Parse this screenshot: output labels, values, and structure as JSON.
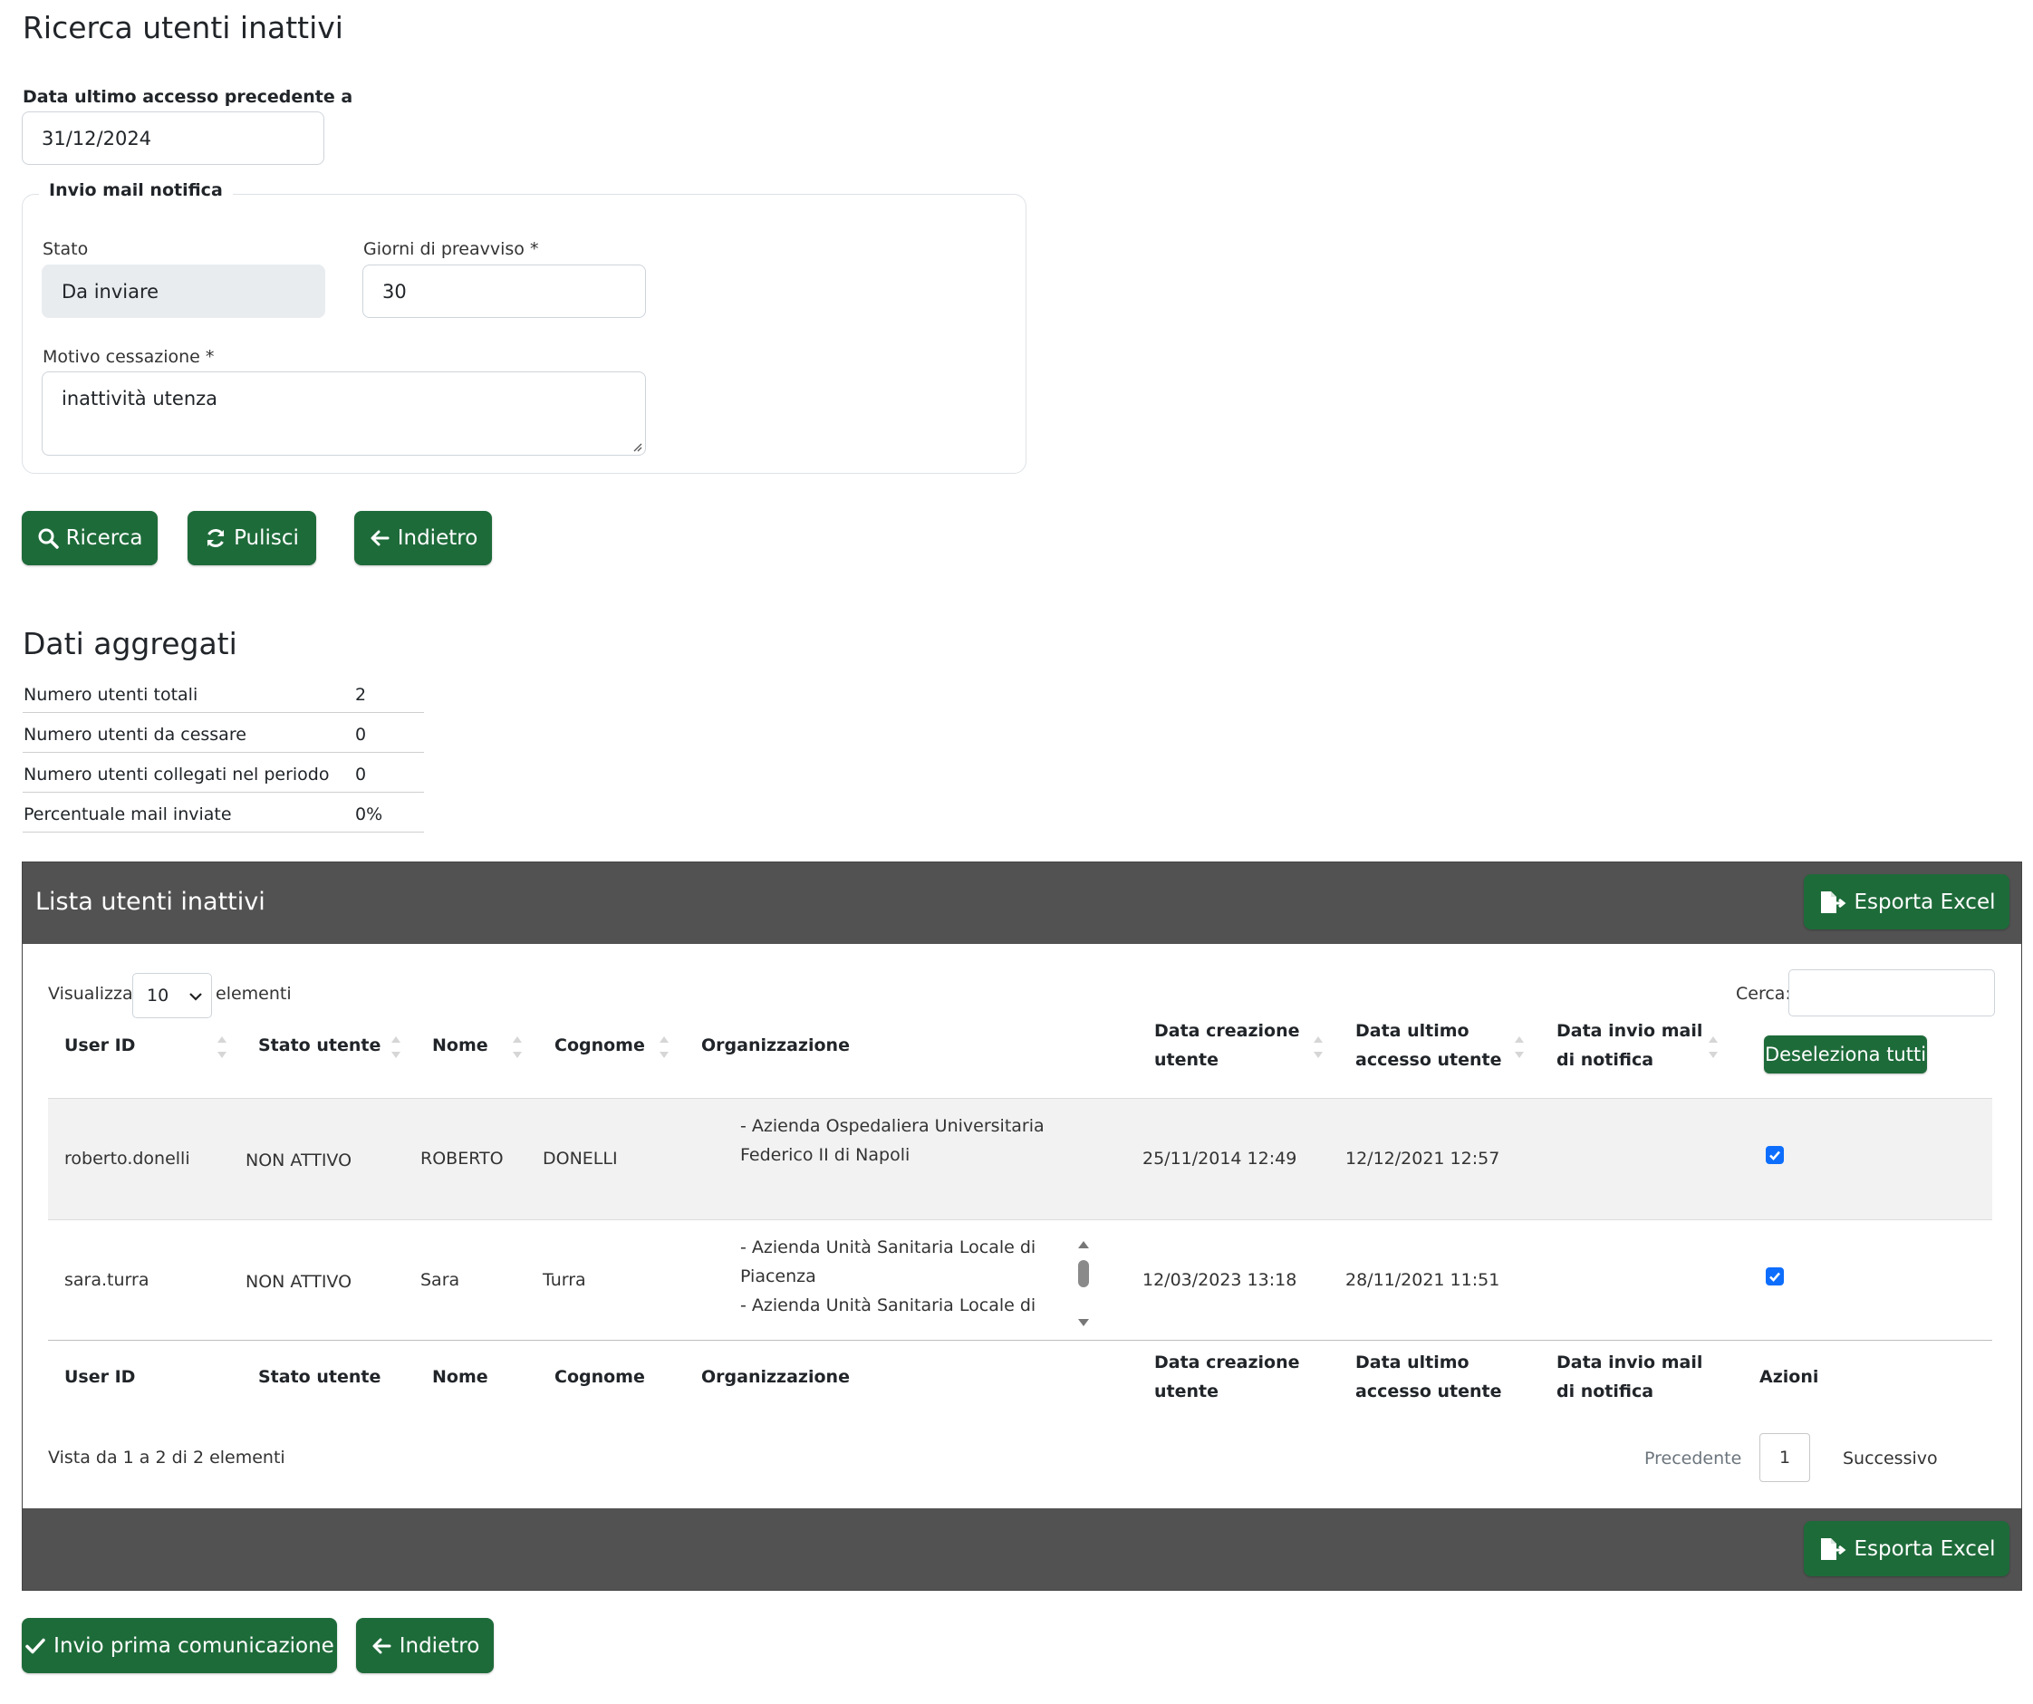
{
  "page": {
    "title": "Ricerca utenti inattivi"
  },
  "search": {
    "last_access_label": "Data ultimo accesso precedente a",
    "last_access_value": "31/12/2024",
    "notification_legend": "Invio mail notifica",
    "stato_label": "Stato",
    "stato_value": "Da inviare",
    "giorni_label": "Giorni di preavviso *",
    "giorni_value": "30",
    "motivo_label": "Motivo cessazione *",
    "motivo_value": "inattività utenza"
  },
  "actions": {
    "ricerca": "Ricerca",
    "pulisci": "Pulisci",
    "indietro": "Indietro"
  },
  "aggregate": {
    "title": "Dati aggregati",
    "rows": [
      {
        "label": "Numero utenti totali",
        "value": "2"
      },
      {
        "label": "Numero utenti da cessare",
        "value": "0"
      },
      {
        "label": "Numero utenti collegati nel periodo",
        "value": "0"
      },
      {
        "label": "Percentuale mail inviate",
        "value": "0%"
      }
    ]
  },
  "list": {
    "title": "Lista utenti inattivi",
    "export_label": "Esporta Excel",
    "show_label": "Visualizza",
    "page_size": "10",
    "elements_label": "elementi",
    "search_label": "Cerca:",
    "search_value": "",
    "deselect_all": "Deseleziona tutti",
    "columns": {
      "user_id": "User ID",
      "stato": "Stato utente",
      "nome": "Nome",
      "cognome": "Cognome",
      "org": "Organizzazione",
      "creazione_1": "Data creazione",
      "creazione_2": "utente",
      "accesso_1": "Data ultimo",
      "accesso_2": "accesso utente",
      "invio_1": "Data invio mail",
      "invio_2": "di notifica",
      "azioni": "Azioni"
    },
    "rows": [
      {
        "user_id": "roberto.donelli",
        "stato": "NON ATTIVO",
        "nome": "ROBERTO",
        "cognome": "DONELLI",
        "org_lines": [
          "- Azienda Ospedaliera Universitaria",
          "Federico II di Napoli"
        ],
        "creazione": "25/11/2014 12:49",
        "accesso": "12/12/2021 12:57",
        "invio": "",
        "selected": true
      },
      {
        "user_id": "sara.turra",
        "stato": "NON ATTIVO",
        "nome": "Sara",
        "cognome": "Turra",
        "org_lines": [
          "- Azienda Unità Sanitaria Locale di",
          "Piacenza",
          "- Azienda Unità Sanitaria Locale di"
        ],
        "creazione": "12/03/2023 13:18",
        "accesso": "28/11/2021 11:51",
        "invio": "",
        "selected": true
      }
    ],
    "info": "Vista da 1 a 2 di 2 elementi",
    "pagination": {
      "prev": "Precedente",
      "current": "1",
      "next": "Successivo"
    }
  },
  "bottom_actions": {
    "invio": "Invio prima comunicazione",
    "indietro": "Indietro"
  },
  "colors": {
    "primary": "#1e6b3a",
    "panel_header": "#525252",
    "checkbox": "#0d6efd"
  }
}
